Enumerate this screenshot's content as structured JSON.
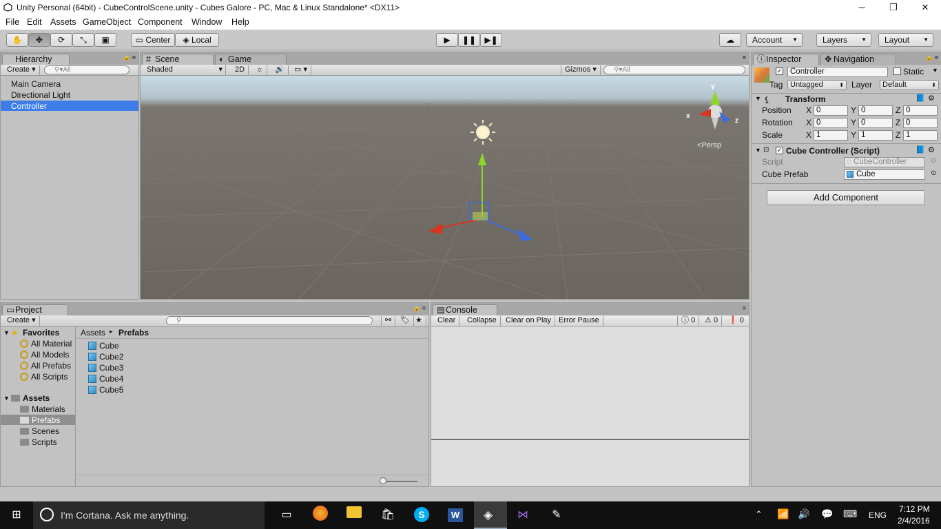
{
  "window": {
    "title": "Unity Personal (64bit) - CubeControlScene.unity - Cubes Galore - PC, Mac & Linux Standalone* <DX11>",
    "minimize": "─",
    "maximize": "❐",
    "close": "✕"
  },
  "menu": [
    "File",
    "Edit",
    "Assets",
    "GameObject",
    "Component",
    "Window",
    "Help"
  ],
  "toolbar": {
    "pivot": "Center",
    "space": "Local",
    "account": "Account",
    "layers": "Layers",
    "layout": "Layout"
  },
  "hierarchy": {
    "tab": "Hierarchy",
    "create": "Create",
    "search": "All",
    "items": [
      "Main Camera",
      "Directional Light",
      "Controller"
    ],
    "selected": 2
  },
  "scene": {
    "tab_scene": "Scene",
    "tab_game": "Game",
    "shading": "Shaded",
    "mode2d": "2D",
    "gizmos": "Gizmos",
    "search": "All",
    "persp": "Persp",
    "axis_x": "x",
    "axis_y": "y",
    "axis_z": "z"
  },
  "inspector": {
    "tab": "Inspector",
    "tab_nav": "Navigation",
    "name": "Controller",
    "static": "Static",
    "tag_label": "Tag",
    "tag": "Untagged",
    "layer_label": "Layer",
    "layer": "Default",
    "transform": {
      "title": "Transform",
      "rows": [
        {
          "label": "Position",
          "x": "0",
          "y": "0",
          "z": "0"
        },
        {
          "label": "Rotation",
          "x": "0",
          "y": "0",
          "z": "0"
        },
        {
          "label": "Scale",
          "x": "1",
          "y": "1",
          "z": "1"
        }
      ]
    },
    "script_comp": {
      "title": "Cube Controller (Script)",
      "script_label": "Script",
      "script_value": "CubeController",
      "prefab_label": "Cube Prefab",
      "prefab_value": "Cube"
    },
    "add_component": "Add Component"
  },
  "project": {
    "tab": "Project",
    "create": "Create",
    "favorites": "Favorites",
    "fav_items": [
      "All Material",
      "All Models",
      "All Prefabs",
      "All Scripts"
    ],
    "assets": "Assets",
    "asset_folders": [
      "Materials",
      "Prefabs",
      "Scenes",
      "Scripts"
    ],
    "breadcrumb_root": "Assets",
    "breadcrumb_current": "Prefabs",
    "files": [
      "Cube",
      "Cube2",
      "Cube3",
      "Cube4",
      "Cube5"
    ]
  },
  "console": {
    "tab": "Console",
    "buttons": [
      "Clear",
      "Collapse",
      "Clear on Play",
      "Error Pause"
    ],
    "info_count": "0",
    "warn_count": "0",
    "error_count": "0"
  },
  "taskbar": {
    "cortana": "I'm Cortana. Ask me anything.",
    "lang": "ENG",
    "time": "7:12 PM",
    "date": "2/4/2016"
  }
}
